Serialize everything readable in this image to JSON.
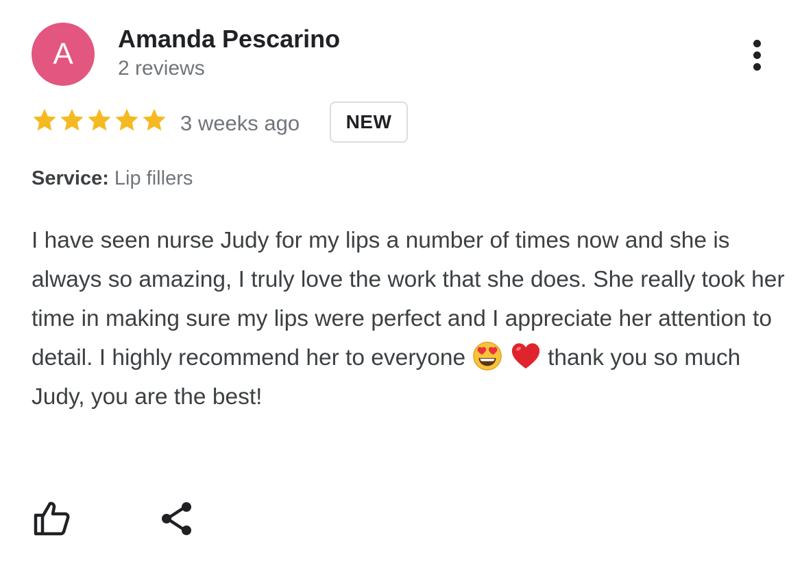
{
  "reviewer": {
    "avatar_letter": "A",
    "avatar_color": "#e2567f",
    "name": "Amanda Pescarino",
    "review_count": "2 reviews"
  },
  "rating": {
    "stars": 5,
    "max_stars": 5,
    "star_color": "#f5b921",
    "time_ago": "3 weeks ago",
    "badge": "NEW"
  },
  "service": {
    "label": "Service:",
    "value": "Lip fillers"
  },
  "review": {
    "text_part1": "I have seen nurse Judy for my lips a number of times now and she is always so amazing, I truly love the work that she does. She really took her time in making sure my lips were perfect and I appreciate her attention to detail. I highly recommend her to everyone",
    "emojis": [
      "heart-eyes-emoji",
      "red-heart-emoji"
    ],
    "text_part2": "thank you so much Judy, you are the best!"
  },
  "icons": {
    "more": "more-vert-icon",
    "like": "thumbs-up-icon",
    "share": "share-icon"
  }
}
